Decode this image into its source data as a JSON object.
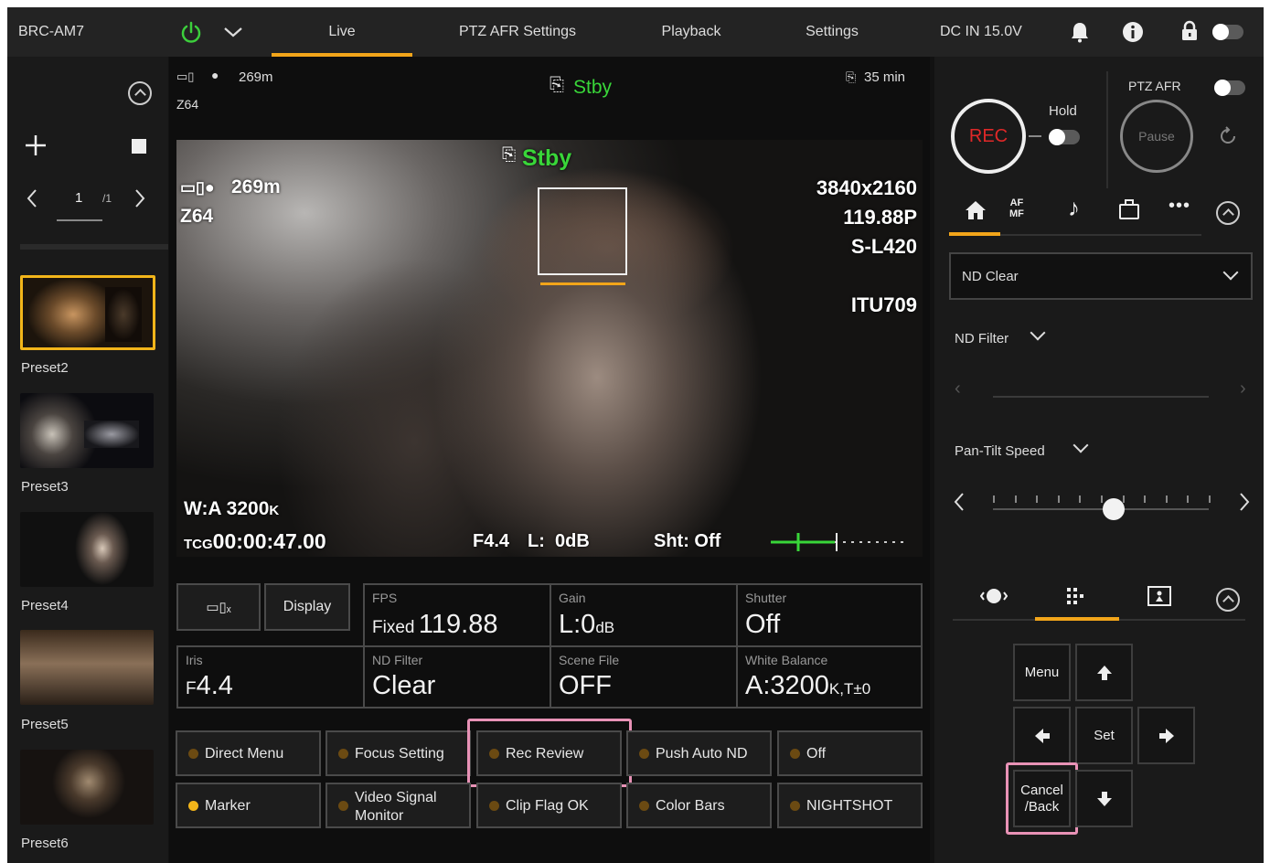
{
  "topbar": {
    "model": "BRC-AM7",
    "tabs": [
      "Live",
      "PTZ AFR Settings",
      "Playback",
      "Settings"
    ],
    "active_tab": "Live",
    "dc_in": "DC IN 15.0V",
    "icons": [
      "power-icon",
      "chevron-down-icon",
      "bell-icon",
      "info-icon",
      "lock-icon"
    ]
  },
  "sidebar": {
    "page_current": "1",
    "page_sep": "/1",
    "presets": [
      {
        "label": "Preset2",
        "selected": true
      },
      {
        "label": "Preset3",
        "selected": false
      },
      {
        "label": "Preset4",
        "selected": false
      },
      {
        "label": "Preset5",
        "selected": false
      },
      {
        "label": "Preset6",
        "selected": false
      }
    ]
  },
  "monitor_header": {
    "remaining": "269m",
    "clip": "Z64",
    "status": "Stby",
    "time": "35 min"
  },
  "video_osd": {
    "status": "Stby",
    "remaining": "269m",
    "clip": "Z64",
    "resolution": "3840x2160",
    "frame_rate": "119.88P",
    "gamma": "S-L420",
    "color_space": "ITU709",
    "white_balance_prefix": "W:A",
    "white_balance_value": "3200",
    "white_balance_unit": "K",
    "timecode_prefix": "TCG",
    "timecode": "00:00:47.00",
    "iris": "F4.4",
    "gain": "L:  0dB",
    "shutter": "Sht: Off"
  },
  "settings_grid": {
    "display_label": "Display",
    "fps_label": "FPS",
    "fps_mode": "Fixed",
    "fps_value": "119.88",
    "gain_label": "Gain",
    "gain_value": "L:0",
    "gain_unit": "dB",
    "shutter_label": "Shutter",
    "shutter_value": "Off",
    "iris_label": "Iris",
    "iris_prefix": "F",
    "iris_value": "4.4",
    "nd_label": "ND Filter",
    "nd_value": "Clear",
    "scene_label": "Scene File",
    "scene_value": "OFF",
    "wb_label": "White Balance",
    "wb_value": "A:3200",
    "wb_suffix": "K,T±0"
  },
  "assign_buttons": [
    {
      "label": "Direct Menu",
      "active": false
    },
    {
      "label": "Focus Setting",
      "active": false
    },
    {
      "label": "Rec Review",
      "active": false
    },
    {
      "label": "Push Auto ND",
      "active": false
    },
    {
      "label": "Off",
      "active": false
    },
    {
      "label": "Marker",
      "active": true
    },
    {
      "label": "Video Signal Monitor",
      "active": false
    },
    {
      "label": "Clip Flag OK",
      "active": false
    },
    {
      "label": "Color Bars",
      "active": false
    },
    {
      "label": "NIGHTSHOT",
      "active": false
    }
  ],
  "right_panel": {
    "rec_label": "REC",
    "hold_label": "Hold",
    "ptz_afr_label": "PTZ AFR",
    "pause_label": "Pause",
    "icon_tabs": [
      "home-icon",
      "af-mf-icon",
      "audio-icon",
      "camera-icon",
      "more-icon"
    ],
    "af_mf_top": "AF",
    "af_mf_bottom": "MF",
    "nd_dropdown_value": "ND Clear",
    "nd_filter_label": "ND Filter",
    "pan_tilt_label": "Pan-Tilt Speed",
    "pan_tilt_level": 0.56,
    "nav_tabs": [
      "ptz-icon",
      "menu-grid-icon",
      "tracking-icon"
    ],
    "menu_label": "Menu",
    "set_label": "Set",
    "cancel_label_1": "Cancel",
    "cancel_label_2": "/Back"
  },
  "colors": {
    "accent": "#f2a51a",
    "rec_red": "#e02828",
    "status_green": "#39d639",
    "highlight_pink": "#e892b6"
  }
}
